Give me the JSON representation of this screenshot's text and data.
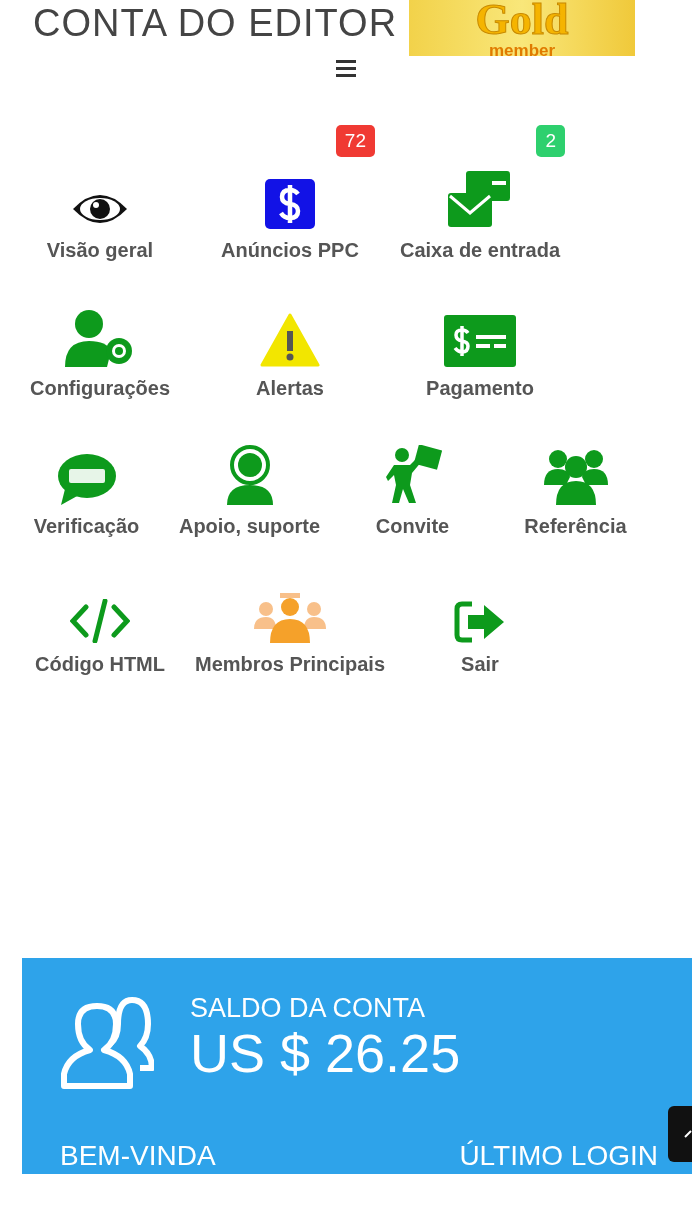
{
  "header": {
    "title": "CONTA DO EDITOR",
    "badge": {
      "word": "Gold",
      "caption": "member"
    }
  },
  "menu_rows": [
    [
      {
        "kind": "eye",
        "label": "Visão geral"
      },
      {
        "kind": "dollar",
        "label": "Anúncios PPC",
        "count": "72",
        "color": "#f03a33"
      },
      {
        "kind": "mail",
        "label": "Caixa de entrada",
        "count": "2",
        "color": "#2ed06e"
      }
    ],
    [
      {
        "kind": "usergear",
        "label": "Configurações"
      },
      {
        "kind": "warning",
        "label": "Alertas"
      },
      {
        "kind": "bill",
        "label": "Pagamento"
      }
    ],
    [
      {
        "kind": "sms",
        "label": "Verificação"
      },
      {
        "kind": "support",
        "label": "Apoio, suporte"
      },
      {
        "kind": "flag",
        "label": "Convite"
      },
      {
        "kind": "group",
        "label": "Referência"
      }
    ],
    [
      {
        "kind": "code",
        "label": "Código HTML"
      },
      {
        "kind": "members",
        "label": "Membros Principais"
      },
      {
        "kind": "signout",
        "label": "Sair"
      }
    ]
  ],
  "balance_card": {
    "label": "SALDO DA CONTA",
    "amount": "US $ 26.25",
    "welcome": "BEM-VINDA",
    "last_login": "ÚLTIMO LOGIN"
  }
}
